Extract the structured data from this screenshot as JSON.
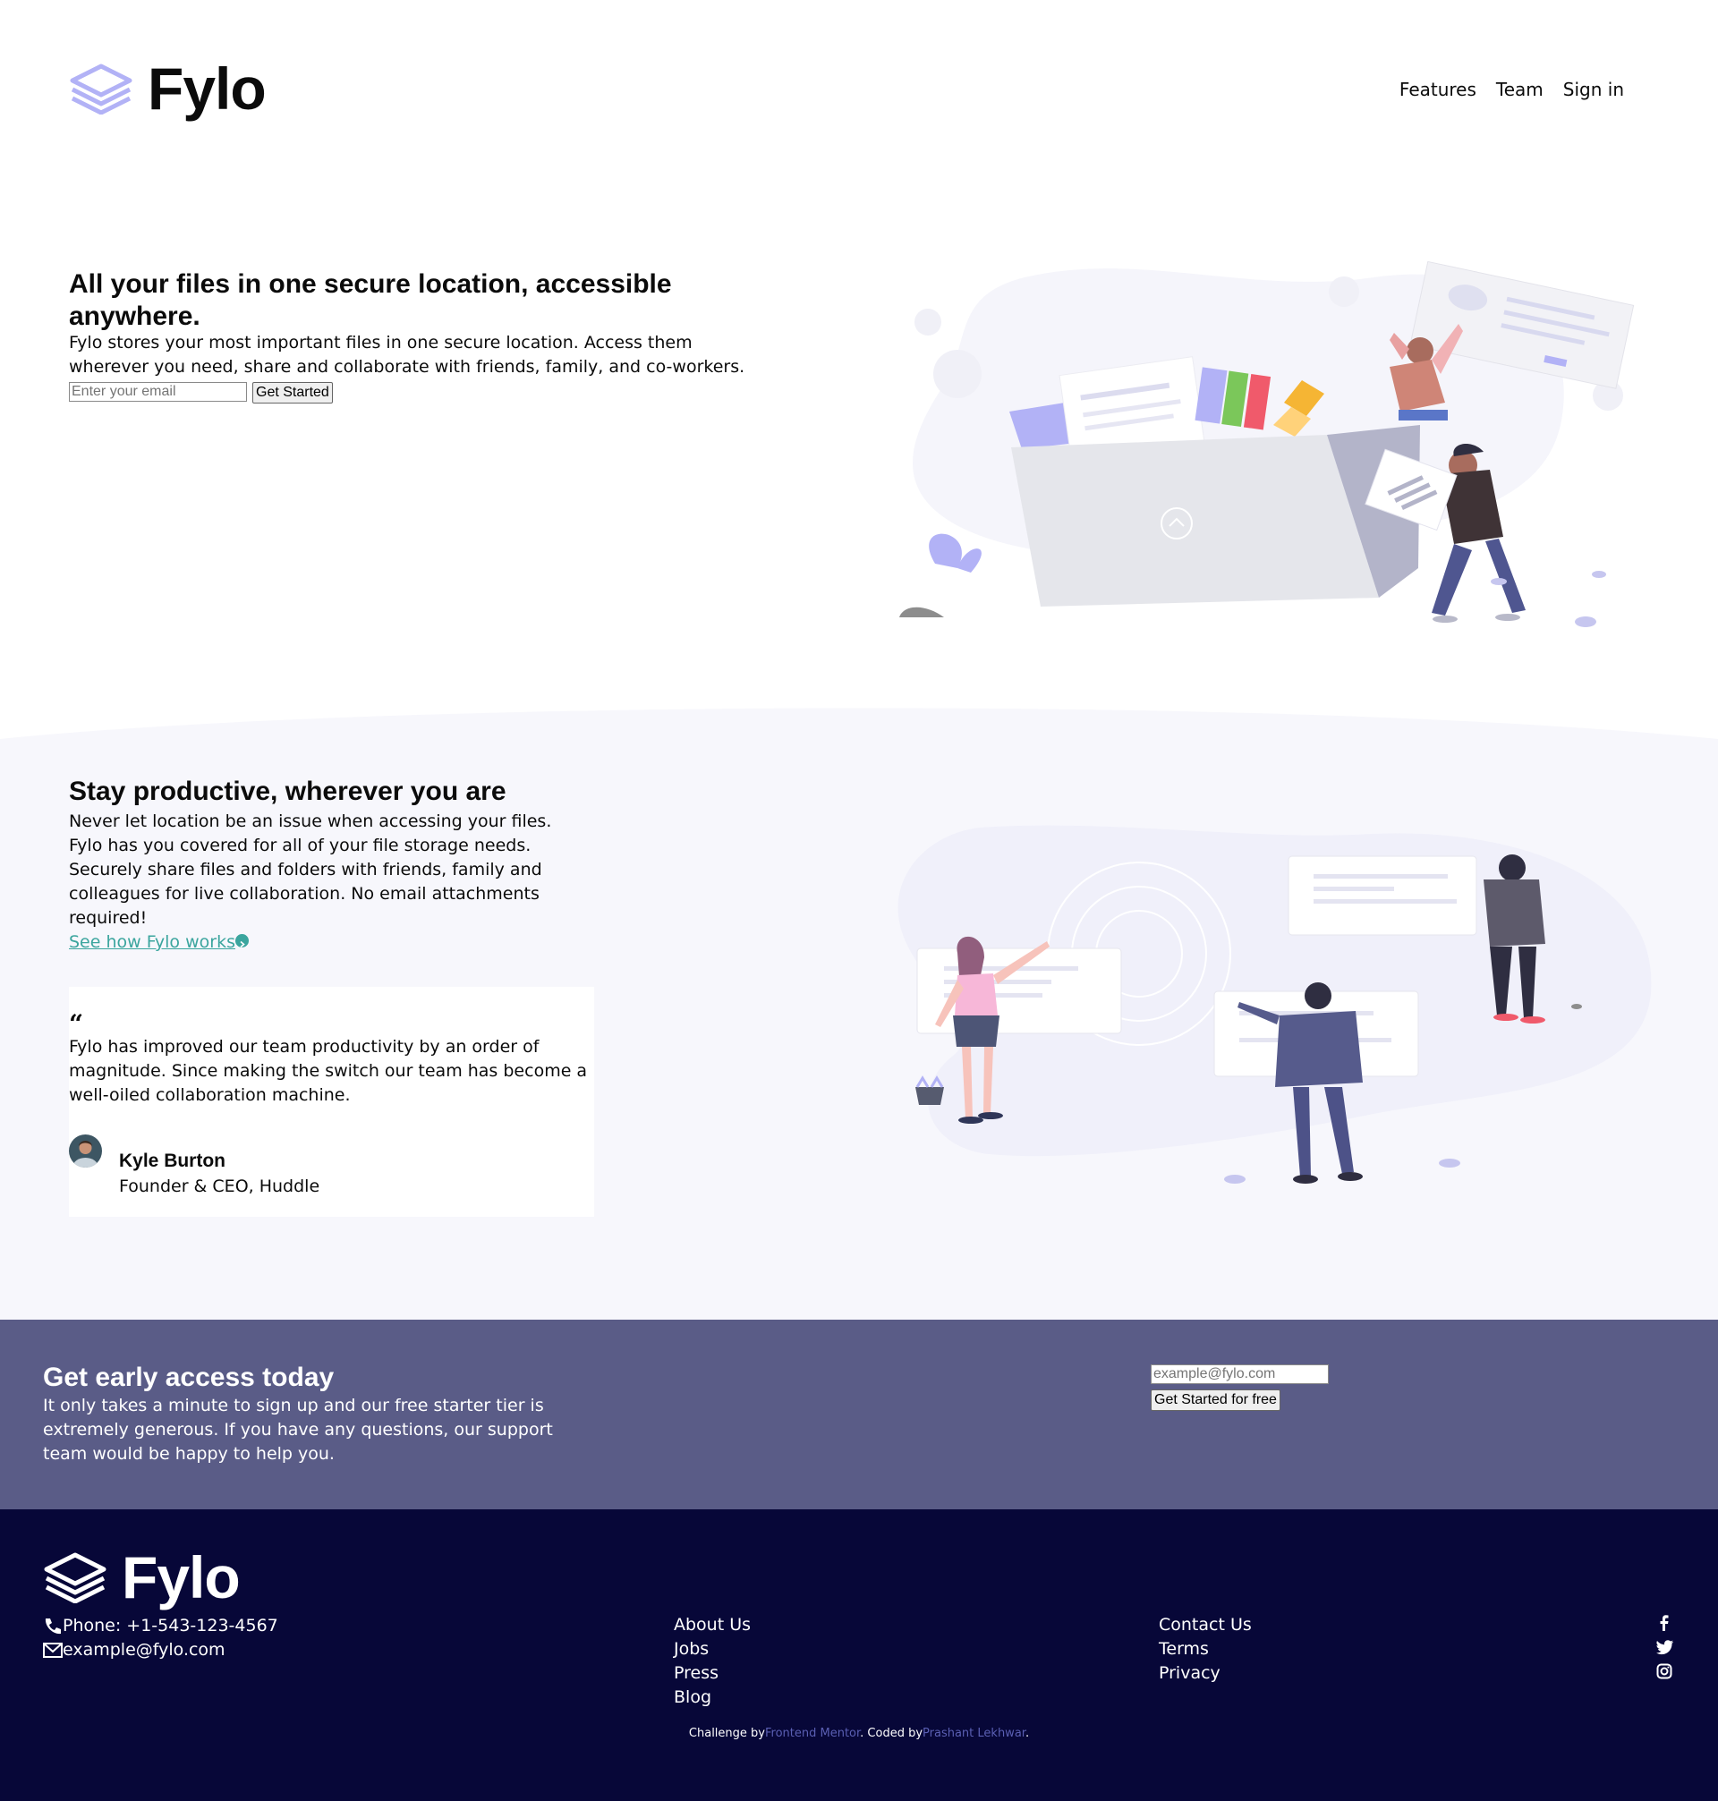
{
  "brand": {
    "name": "Fylo"
  },
  "nav": {
    "features": "Features",
    "team": "Team",
    "signin": "Sign in"
  },
  "hero": {
    "title": "All your files in one secure location, accessible anywhere.",
    "text": "Fylo stores your most important files in one secure location. Access them wherever you need, share and collaborate with friends, family, and co-workers.",
    "email_placeholder": "Enter your email",
    "button": "Get Started"
  },
  "productive": {
    "title": "Stay productive, wherever you are",
    "p1": "Never let location be an issue when accessing your files. Fylo has you covered for all of your file storage needs.",
    "p2": "Securely share files and folders with friends, family and colleagues for live collaboration. No email attachments required!",
    "link": "See how Fylo works"
  },
  "testimonial": {
    "quote_mark": "“",
    "text": "Fylo has improved our team productivity by an order of magnitude. Since making the switch our team has become a well-oiled collaboration machine.",
    "name": "Kyle Burton",
    "role": "Founder & CEO, Huddle"
  },
  "cta": {
    "title": "Get early access today",
    "text": "It only takes a minute to sign up and our free starter tier is extremely generous. If you have any questions, our support team would be happy to help you.",
    "email_placeholder": "example@fylo.com",
    "button": "Get Started for free"
  },
  "footer": {
    "phone": "Phone: +1-543-123-4567",
    "email": "example@fylo.com",
    "col1": [
      "About Us",
      "Jobs",
      "Press",
      "Blog"
    ],
    "col2": [
      "Contact Us",
      "Terms",
      "Privacy"
    ],
    "socials": [
      "facebook-icon",
      "twitter-icon",
      "instagram-icon"
    ],
    "credit_prefix": "Challenge by",
    "credit_fm": "Frontend Mentor",
    "credit_mid": ". Coded by",
    "credit_author": "Prashant Lekhwar",
    "credit_end": "."
  },
  "colors": {
    "accent_teal": "#3ba59e",
    "cta_bg": "#5a5c87",
    "footer_bg": "#070738",
    "section_bg": "#f7f7fc",
    "illustration_purple": "#b2b2f6"
  }
}
